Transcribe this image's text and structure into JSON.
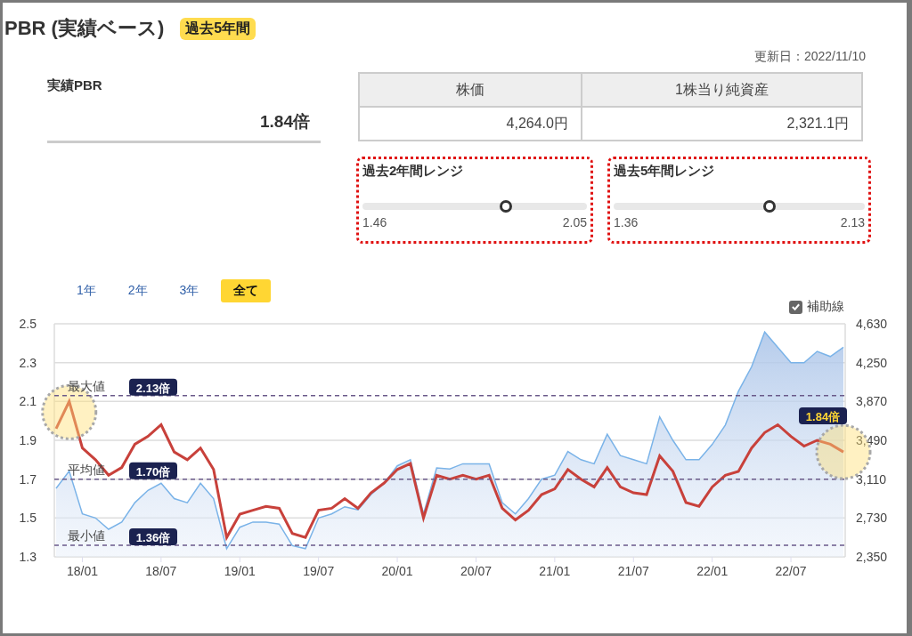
{
  "header": {
    "title": "PBR (実績ベース)",
    "badge": "過去5年間"
  },
  "actual": {
    "label": "実績PBR",
    "value": "1.84倍"
  },
  "updated": "更新日：2022/11/10",
  "table": {
    "columns": [
      "株価",
      "1株当り純資産"
    ],
    "rows": [
      [
        "4,264.0円",
        "2,321.1円"
      ]
    ]
  },
  "ranges": [
    {
      "title": "過去2年間レンジ",
      "level": 0.64,
      "min": "1.46",
      "max": "2.05"
    },
    {
      "title": "過去5年間レンジ",
      "level": 0.62,
      "min": "1.36",
      "max": "2.13"
    }
  ],
  "period_tabs": [
    {
      "label": "1年",
      "selected": false
    },
    {
      "label": "2年",
      "selected": false
    },
    {
      "label": "3年",
      "selected": false
    },
    {
      "label": "全て",
      "selected": true
    }
  ],
  "guide_lines": {
    "label": "補助線",
    "checked": true
  },
  "chart_data": {
    "type": "line",
    "categories": [
      null,
      null,
      "18/01",
      null,
      null,
      null,
      null,
      null,
      "18/07",
      null,
      null,
      null,
      null,
      null,
      "19/01",
      null,
      null,
      null,
      null,
      null,
      "19/07",
      null,
      null,
      null,
      null,
      null,
      "20/01",
      null,
      null,
      null,
      null,
      null,
      "20/07",
      null,
      null,
      null,
      null,
      null,
      "21/01",
      null,
      null,
      null,
      null,
      null,
      "21/07",
      null,
      null,
      null,
      null,
      null,
      "22/01",
      null,
      null,
      null,
      null,
      null,
      "22/07",
      null,
      null,
      null,
      null
    ],
    "series": [
      {
        "type": "area",
        "color": "#7ab3e8",
        "axis": "y2",
        "values": [
          3020,
          3190,
          2770,
          2730,
          2620,
          2690,
          2880,
          3000,
          3070,
          2920,
          2880,
          3070,
          2920,
          2430,
          2640,
          2690,
          2690,
          2670,
          2460,
          2430,
          2730,
          2770,
          2840,
          2810,
          2960,
          3070,
          3240,
          3300,
          2770,
          3220,
          3210,
          3260,
          3260,
          3260,
          2880,
          2770,
          2920,
          3110,
          3150,
          3380,
          3300,
          3260,
          3550,
          3340,
          3300,
          3260,
          3720,
          3490,
          3300,
          3300,
          3450,
          3640,
          3970,
          4210,
          4550,
          4400,
          4250,
          4250,
          4360,
          4310,
          4400
        ]
      },
      {
        "type": "line",
        "color": "#c8413b",
        "values": [
          1.96,
          2.1,
          1.86,
          1.8,
          1.72,
          1.76,
          1.88,
          1.92,
          1.98,
          1.84,
          1.8,
          1.86,
          1.75,
          1.4,
          1.52,
          1.54,
          1.56,
          1.55,
          1.42,
          1.4,
          1.54,
          1.55,
          1.6,
          1.55,
          1.63,
          1.68,
          1.75,
          1.78,
          1.5,
          1.72,
          1.7,
          1.72,
          1.7,
          1.72,
          1.55,
          1.49,
          1.54,
          1.62,
          1.65,
          1.75,
          1.7,
          1.66,
          1.76,
          1.66,
          1.63,
          1.62,
          1.82,
          1.74,
          1.58,
          1.56,
          1.66,
          1.72,
          1.74,
          1.86,
          1.94,
          1.98,
          1.92,
          1.87,
          1.9,
          1.88,
          1.84
        ]
      }
    ],
    "ylim": [
      1.3,
      2.5
    ],
    "yticks": [
      1.3,
      1.5,
      1.7,
      1.9,
      2.1,
      2.3,
      2.5
    ],
    "y2lim": [
      2350,
      4630
    ],
    "y2ticks": [
      {
        "value": 2350,
        "label": "2,350"
      },
      {
        "value": 2730,
        "label": "2,730"
      },
      {
        "value": 3110,
        "label": "3,110"
      },
      {
        "value": 3490,
        "label": "3,490"
      },
      {
        "value": 3870,
        "label": "3,870"
      },
      {
        "value": 4250,
        "label": "4,250"
      },
      {
        "value": 4630,
        "label": "4,630"
      }
    ],
    "grid": true,
    "ref_lines": [
      {
        "axis": "y",
        "value": 2.13,
        "label": "2.13倍"
      },
      {
        "axis": "y",
        "value": 1.7,
        "label": "1.70倍"
      },
      {
        "axis": "y",
        "value": 1.36,
        "label": "1.36倍"
      }
    ],
    "annotations": [
      "最大値",
      "平均値",
      "最小値",
      "1.84倍"
    ]
  }
}
